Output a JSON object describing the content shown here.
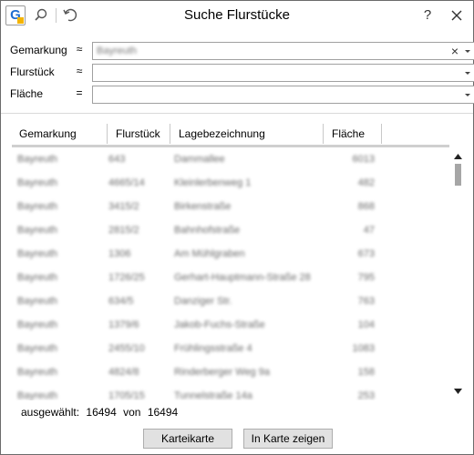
{
  "window": {
    "title": "Suche Flurstücke",
    "help_label": "?"
  },
  "form": {
    "gemarkung": {
      "label": "Gemarkung",
      "operator": "≈",
      "value": "Bayreuth"
    },
    "flurstueck": {
      "label": "Flurstück",
      "operator": "≈",
      "value": ""
    },
    "flaeche": {
      "label": "Fläche",
      "operator": "=",
      "value": ""
    }
  },
  "table": {
    "columns": [
      "Gemarkung",
      "Flurstück",
      "Lagebezeichnung",
      "Fläche"
    ],
    "rows": [
      [
        "Bayreuth",
        "643",
        "Dammallee",
        "6013"
      ],
      [
        "Bayreuth",
        "4665/14",
        "Kleinlerbenweg 1",
        "482"
      ],
      [
        "Bayreuth",
        "3415/2",
        "Birkenstraße",
        "868"
      ],
      [
        "Bayreuth",
        "2815/2",
        "Bahnhofstraße",
        "47"
      ],
      [
        "Bayreuth",
        "1306",
        "Am Mühlgraben",
        "673"
      ],
      [
        "Bayreuth",
        "1726/25",
        "Gerhart-Hauptmann-Straße 28",
        "795"
      ],
      [
        "Bayreuth",
        "634/5",
        "Danziger Str.",
        "763"
      ],
      [
        "Bayreuth",
        "1379/6",
        "Jakob-Fuchs-Straße",
        "104"
      ],
      [
        "Bayreuth",
        "2455/10",
        "Frühlingsstraße 4",
        "1083"
      ],
      [
        "Bayreuth",
        "4824/8",
        "Rinderberger Weg 9a",
        "158"
      ],
      [
        "Bayreuth",
        "1705/15",
        "Tunnelstraße 14a",
        "253"
      ]
    ]
  },
  "status": {
    "selected_label": "ausgewählt:",
    "selected_count": "16494",
    "of_label": "von",
    "total_count": "16494"
  },
  "buttons": {
    "karteikarte": "Karteikarte",
    "in_karte_zeigen": "In Karte zeigen"
  },
  "icons": {
    "app": "app-logo-icon",
    "search": "search-icon",
    "undo": "undo-icon",
    "close": "close-icon"
  },
  "colors": {
    "accent": "#1f6fd1",
    "logo_corner": "#f4b400"
  }
}
